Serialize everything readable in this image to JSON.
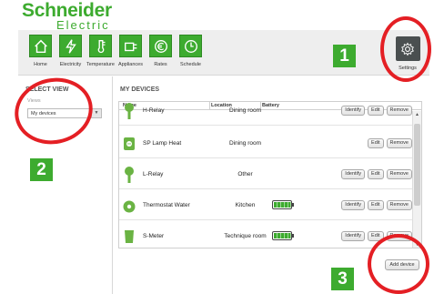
{
  "brand": {
    "name": "Schneider",
    "sub": "Electric"
  },
  "nav": [
    {
      "label": "Home",
      "icon": "home-icon"
    },
    {
      "label": "Electricity",
      "icon": "lightning-icon"
    },
    {
      "label": "Temperature",
      "icon": "thermometer-icon"
    },
    {
      "label": "Appliances",
      "icon": "appliance-icon"
    },
    {
      "label": "Rates",
      "icon": "rates-icon"
    },
    {
      "label": "Schedule",
      "icon": "clock-icon"
    }
  ],
  "settings": {
    "label": "Settings",
    "icon": "gear-icon"
  },
  "badges": {
    "one": "1",
    "two": "2",
    "three": "3"
  },
  "left_panel": {
    "title": "SELECT VIEW",
    "views_label": "Views",
    "views_value": "My devices"
  },
  "main": {
    "title": "MY DEVICES",
    "columns": {
      "name": "Name",
      "location": "Location",
      "battery": "Battery"
    },
    "rows": [
      {
        "name": "H-Relay",
        "location": "Dining room",
        "icon": "relay-icon",
        "battery": false,
        "identify": true,
        "edit": true,
        "remove": true
      },
      {
        "name": "SP Lamp Heat",
        "location": "Dining room",
        "icon": "smart-plug-icon",
        "battery": false,
        "identify": false,
        "edit": true,
        "remove": true
      },
      {
        "name": "L-Relay",
        "location": "Other",
        "icon": "relay-icon",
        "battery": false,
        "identify": true,
        "edit": true,
        "remove": true
      },
      {
        "name": "Thermostat Water",
        "location": "Kitchen",
        "icon": "thermostat-icon",
        "battery": true,
        "identify": true,
        "edit": true,
        "remove": true
      },
      {
        "name": "S-Meter",
        "location": "Technique room",
        "icon": "meter-icon",
        "battery": true,
        "identify": true,
        "edit": true,
        "remove": true
      }
    ],
    "buttons": {
      "identify": "Identify",
      "edit": "Edit",
      "remove": "Remove"
    },
    "add_label": "Add device"
  },
  "colors": {
    "brand_green": "#3dab2f",
    "highlight_red": "#e41f24",
    "settings_dark": "#4a4f50"
  }
}
